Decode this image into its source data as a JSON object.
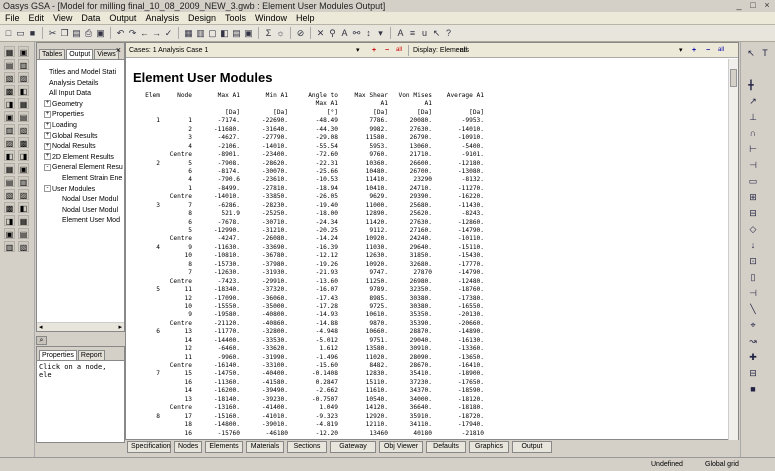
{
  "window": {
    "title": "Oasys GSA - [Model for milling final_10_08_2009_NEW_3.gwb : Element User Modules Output]"
  },
  "menu": [
    "File",
    "Edit",
    "View",
    "Data",
    "Output",
    "Analysis",
    "Design",
    "Tools",
    "Window",
    "Help"
  ],
  "panel": {
    "tabs": [
      "Tables",
      "Output",
      "Views"
    ],
    "close": "×",
    "tree": [
      {
        "label": "Titles and Model Stati",
        "indent": 1,
        "exp": ""
      },
      {
        "label": "Analysis Details",
        "indent": 1,
        "exp": ""
      },
      {
        "label": "All Input Data",
        "indent": 1,
        "exp": ""
      },
      {
        "label": "Geometry",
        "indent": 0,
        "exp": "+"
      },
      {
        "label": "Properties",
        "indent": 0,
        "exp": "+"
      },
      {
        "label": "Loading",
        "indent": 0,
        "exp": "+"
      },
      {
        "label": "Global Results",
        "indent": 0,
        "exp": "+"
      },
      {
        "label": "Nodal Results",
        "indent": 0,
        "exp": "+"
      },
      {
        "label": "2D Element Results",
        "indent": 0,
        "exp": "+"
      },
      {
        "label": "General Element Resu",
        "indent": 0,
        "exp": "-"
      },
      {
        "label": "Element Strain Ene",
        "indent": 2,
        "exp": ""
      },
      {
        "label": "User Modules",
        "indent": 0,
        "exp": "-"
      },
      {
        "label": "Nodal User Modul",
        "indent": 2,
        "exp": ""
      },
      {
        "label": "Nodal User Modul",
        "indent": 2,
        "exp": ""
      },
      {
        "label": "Element User Mod",
        "indent": 2,
        "exp": ""
      }
    ]
  },
  "props": {
    "tabs": [
      "Properties",
      "Report"
    ],
    "text": "Click on a node, ele"
  },
  "casebar": {
    "cases": "Cases: 1  Analysis Case 1",
    "display": "Display: Elements",
    "filter": ": all"
  },
  "report": {
    "title": "Element User Modules",
    "headers": [
      [
        "Elem",
        "Node",
        "Max A1",
        "Min A1",
        "Angle to",
        "Max Shear",
        "Von Mises",
        "Average A1"
      ],
      [
        "",
        "",
        "",
        "",
        "Max A1",
        "A1",
        "A1",
        ""
      ],
      [
        "",
        "",
        "[Da]",
        "[Da]",
        "[°]",
        "[Da]",
        "[Da]",
        "[Da]"
      ]
    ],
    "rows": [
      [
        "1",
        "1",
        "-7174.",
        "-22690.",
        "-48.49",
        "7786.",
        "20080.",
        "-9953."
      ],
      [
        "",
        "2",
        "-11680.",
        "-31640.",
        "-44.30",
        "9982.",
        "27630.",
        "-14010."
      ],
      [
        "",
        "3",
        "-4627.",
        "-27790.",
        "-29.08",
        "11580.",
        "26790.",
        "-10910."
      ],
      [
        "",
        "4",
        "-2106.",
        "-14010.",
        "-55.54",
        "5953.",
        "13060.",
        "-5400."
      ],
      [
        "",
        "Centre",
        "-8901.",
        "-23400.",
        "-72.60",
        "9760.",
        "21710.",
        "-9101."
      ],
      [
        "2",
        "5",
        "-7908.",
        "-28620.",
        "-22.31",
        "10360.",
        "26600.",
        "-12180."
      ],
      [
        "",
        "6",
        "-8174.",
        "-30070.",
        "-25.66",
        "10480.",
        "26700.",
        "-13080."
      ],
      [
        "",
        "4",
        "-790.6",
        "-23610.",
        "-10.53",
        "11410.",
        "23290",
        "-8132."
      ],
      [
        "",
        "1",
        "-8499.",
        "-27810.",
        "-18.94",
        "10410.",
        "24710.",
        "-11270."
      ],
      [
        "",
        "Centre",
        "-14010.",
        "-33850.",
        "-26.05",
        "9629.",
        "29390.",
        "-16220."
      ],
      [
        "3",
        "7",
        "-6286.",
        "-28230.",
        "-19.40",
        "11000.",
        "25680.",
        "-11430."
      ],
      [
        "",
        "8",
        "521.9",
        "-25250.",
        "-18.00",
        "12890.",
        "25620.",
        "-8243."
      ],
      [
        "",
        "6",
        "-7678.",
        "-30710.",
        "-24.34",
        "11420.",
        "27630.",
        "-12860."
      ],
      [
        "",
        "5",
        "-12990.",
        "-31210.",
        "-20.25",
        "9112.",
        "27160.",
        "-14790."
      ],
      [
        "",
        "Centre",
        "-4247.",
        "-26080.",
        "-14.24",
        "10920.",
        "24240.",
        "-10110."
      ],
      [
        "4",
        "9",
        "-11630.",
        "-33690.",
        "-16.39",
        "11030.",
        "29640.",
        "-15110."
      ],
      [
        "",
        "10",
        "-10810.",
        "-36780.",
        "-12.12",
        "12630.",
        "31850.",
        "-15430."
      ],
      [
        "",
        "8",
        "-15730.",
        "-37980.",
        "-19.26",
        "10920.",
        "32680.",
        "-17770."
      ],
      [
        "",
        "7",
        "-12630.",
        "-31930.",
        "-21.93",
        "9747.",
        "27870",
        "-14790."
      ],
      [
        "",
        "Centre",
        "-7423.",
        "-29910.",
        "-13.60",
        "11250.",
        "26980.",
        "-12480."
      ],
      [
        "5",
        "11",
        "-18340.",
        "-37320.",
        "-16.07",
        "9789.",
        "32350.",
        "-18760."
      ],
      [
        "",
        "12",
        "-17090.",
        "-36060.",
        "-17.43",
        "8985.",
        "30380.",
        "-17380."
      ],
      [
        "",
        "10",
        "-15550.",
        "-35000.",
        "-17.28",
        "9725.",
        "30380.",
        "-16550."
      ],
      [
        "",
        "9",
        "-19580.",
        "-40800.",
        "-14.93",
        "10610.",
        "35350.",
        "-20130."
      ],
      [
        "",
        "Centre",
        "-21120.",
        "-40860.",
        "-14.88",
        "9870.",
        "35390.",
        "-20660."
      ],
      [
        "6",
        "13",
        "-11770.",
        "-32800.",
        "-4.948",
        "10660.",
        "28870.",
        "-14890."
      ],
      [
        "",
        "14",
        "-14400.",
        "-33530.",
        "-5.012",
        "9751.",
        "29040.",
        "-16130."
      ],
      [
        "",
        "12",
        "-6460.",
        "-33620.",
        "1.612",
        "13580.",
        "30910.",
        "-13360."
      ],
      [
        "",
        "11",
        "-9960.",
        "-31990.",
        "-1.496",
        "11020.",
        "28090.",
        "-13650."
      ],
      [
        "",
        "Centre",
        "-16140.",
        "-33100.",
        "-15.60",
        "8482.",
        "28670.",
        "-16410."
      ],
      [
        "7",
        "15",
        "-14750.",
        "-40400.",
        "-0.1408",
        "12830.",
        "35410.",
        "-18900."
      ],
      [
        "",
        "16",
        "-11360.",
        "-41580.",
        "0.2847",
        "15110.",
        "37230.",
        "-17650."
      ],
      [
        "",
        "14",
        "-16200.",
        "-39490.",
        "-2.662",
        "11610.",
        "34370.",
        "-18590."
      ],
      [
        "",
        "13",
        "-18140.",
        "-39230.",
        "-0.7507",
        "10540.",
        "34000.",
        "-18120."
      ],
      [
        "",
        "Centre",
        "-13160.",
        "-41400.",
        "1.049",
        "14120.",
        "36640.",
        "-18180."
      ],
      [
        "8",
        "17",
        "-15160.",
        "-41010.",
        "-9.323",
        "12920.",
        "35910.",
        "-18720."
      ],
      [
        "",
        "18",
        "-14800.",
        "-39010.",
        "-4.819",
        "12110.",
        "34110.",
        "-17940."
      ],
      [
        "",
        "16",
        "-15760",
        "-46180",
        "-12.20",
        "13460",
        "40180",
        "-21810"
      ]
    ]
  },
  "bottom_tabs": [
    "Specification",
    "Nodes",
    "Elements",
    "Materials",
    "Sections",
    "Gateway",
    "Obj Viewer",
    "Defaults",
    "Graphics",
    "Output"
  ],
  "status": {
    "mode": "Undefined",
    "grid": "Global grid"
  }
}
